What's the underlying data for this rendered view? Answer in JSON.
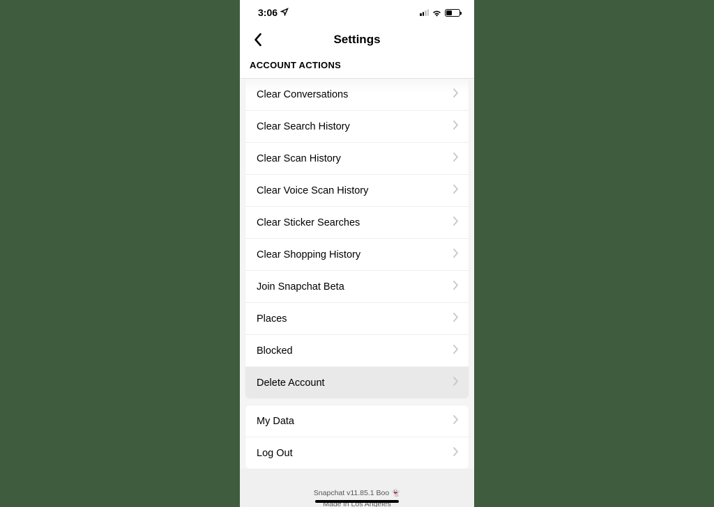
{
  "status": {
    "time": "3:06",
    "battery_pct": 45
  },
  "header": {
    "title": "Settings"
  },
  "section_title": "ACCOUNT ACTIONS",
  "rows": {
    "clear_conversations": "Clear Conversations",
    "clear_search_history": "Clear Search History",
    "clear_scan_history": "Clear Scan History",
    "clear_voice_scan_history": "Clear Voice Scan History",
    "clear_sticker_searches": "Clear Sticker Searches",
    "clear_shopping_history": "Clear Shopping History",
    "join_beta": "Join Snapchat Beta",
    "places": "Places",
    "blocked": "Blocked",
    "delete_account": "Delete Account",
    "my_data": "My Data",
    "log_out": "Log Out"
  },
  "footer": {
    "line1": "Snapchat v11.85.1 Boo 👻",
    "line2": "Made in Los Angeles"
  }
}
